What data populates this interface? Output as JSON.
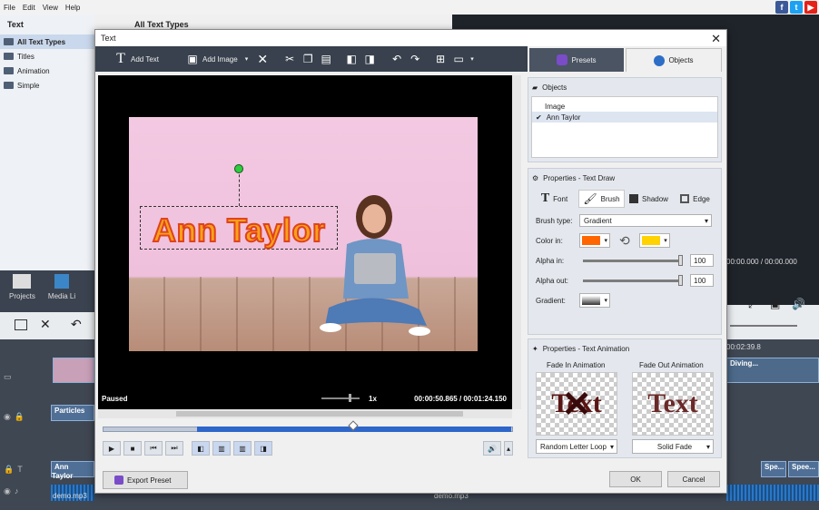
{
  "bg_app": {
    "menu": [
      "File",
      "Edit",
      "View",
      "Help"
    ],
    "left_header": "Text",
    "panel_header": "All Text Types",
    "tree": [
      {
        "label": "All Text Types",
        "selected": true
      },
      {
        "label": "Titles",
        "selected": false
      },
      {
        "label": "Animation",
        "selected": false
      },
      {
        "label": "Simple",
        "selected": false
      }
    ],
    "nav": [
      "Projects",
      "Media Li"
    ],
    "timecode_top": "00:00.000 / 00:00.000",
    "timecode_right": "00:02:39.8",
    "clip_labels": {
      "particles": "Particles",
      "ann": "Ann Taylor",
      "diving": "Diving...",
      "spe1": "Spe...",
      "spe2": "Spee..."
    },
    "audio_files": [
      "demo.mp3",
      "demo.mp3"
    ],
    "social": [
      "f",
      "t",
      "▶"
    ]
  },
  "dialog": {
    "title": "Text",
    "toolbar": {
      "add_text": "Add Text",
      "add_image": "Add Image"
    },
    "tabs": {
      "presets": "Presets",
      "objects": "Objects"
    },
    "preview": {
      "text": "Ann Taylor",
      "status": "Paused",
      "speed": "1x",
      "time": "00:00:50.865 / 00:01:24.150"
    },
    "objects_section": {
      "header": "Objects",
      "items": [
        {
          "label": "Image",
          "checked": false
        },
        {
          "label": "Ann Taylor",
          "checked": true
        }
      ]
    },
    "properties_draw": {
      "header": "Properties - Text Draw",
      "subtabs": [
        "Font",
        "Brush",
        "Shadow",
        "Edge"
      ],
      "brush_type_label": "Brush type:",
      "brush_type_value": "Gradient",
      "color_in_label": "Color in:",
      "color_a": "#ff6600",
      "color_b": "#ffd200",
      "alpha_in_label": "Alpha in:",
      "alpha_in_value": "100",
      "alpha_out_label": "Alpha out:",
      "alpha_out_value": "100",
      "gradient_label": "Gradient:"
    },
    "properties_anim": {
      "header": "Properties - Text Animation",
      "fade_in_label": "Fade In Animation",
      "fade_out_label": "Fade Out Animation",
      "preview_text": "Text",
      "fade_in_value": "Random Letter Loop",
      "fade_out_value": "Solid Fade"
    },
    "buttons": {
      "export": "Export Preset",
      "ok": "OK",
      "cancel": "Cancel"
    }
  }
}
